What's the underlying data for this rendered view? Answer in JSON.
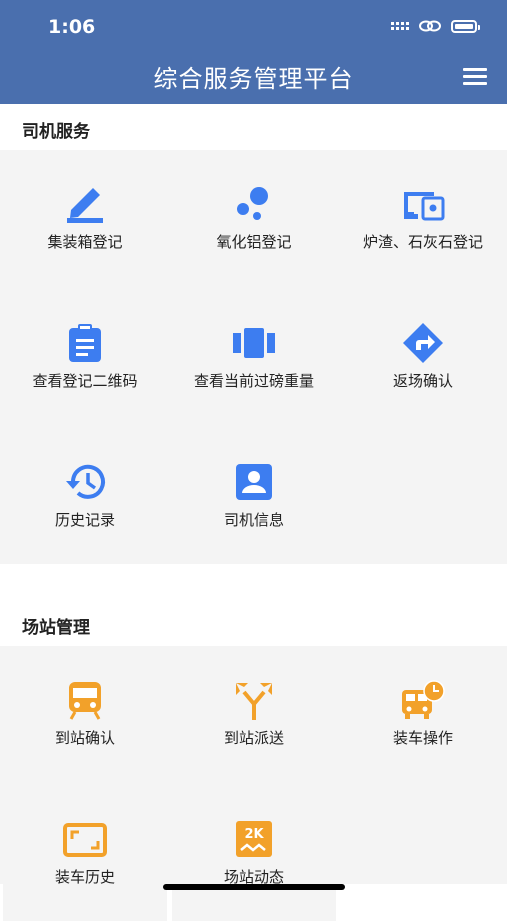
{
  "status": {
    "time": "1:06"
  },
  "header": {
    "title": "综合服务管理平台"
  },
  "sections": [
    {
      "title": "司机服务",
      "items": [
        {
          "label": "集装箱登记",
          "icon": "pencil-icon"
        },
        {
          "label": "氧化铝登记",
          "icon": "bubbles-icon"
        },
        {
          "label": "炉渣、石灰石登记",
          "icon": "devices-icon"
        },
        {
          "label": "查看登记二维码",
          "icon": "clipboard-icon"
        },
        {
          "label": "查看当前过磅重量",
          "icon": "carousel-icon"
        },
        {
          "label": "返场确认",
          "icon": "turn-right-icon"
        },
        {
          "label": "历史记录",
          "icon": "history-icon"
        },
        {
          "label": "司机信息",
          "icon": "contact-card-icon"
        }
      ]
    },
    {
      "title": "场站管理",
      "items": [
        {
          "label": "到站确认",
          "icon": "train-icon"
        },
        {
          "label": "到站派送",
          "icon": "split-arrow-icon"
        },
        {
          "label": "装车操作",
          "icon": "bus-clock-icon"
        },
        {
          "label": "装车历史",
          "icon": "frame-icon"
        },
        {
          "label": "场站动态",
          "icon": "2k-icon"
        }
      ]
    }
  ],
  "colors": {
    "header": "#4a6fae",
    "blue": "#3d7df0",
    "orange": "#f2a12a"
  }
}
